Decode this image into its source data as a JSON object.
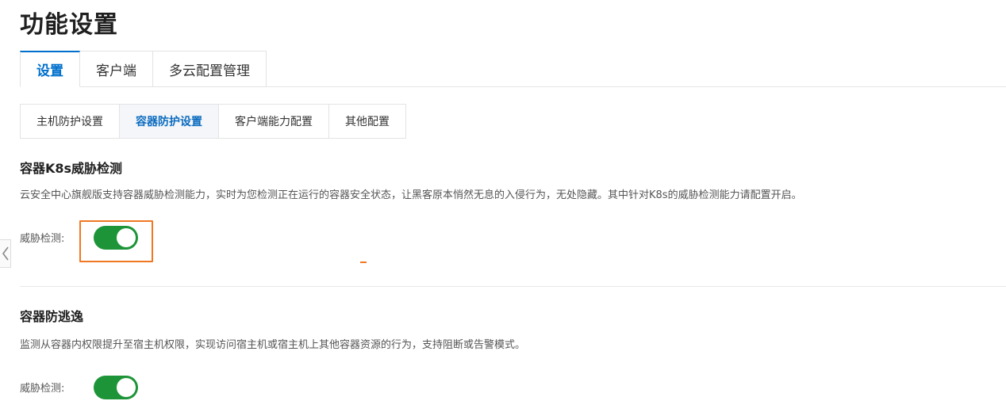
{
  "page": {
    "title": "功能设置"
  },
  "main_tabs": [
    {
      "label": "设置",
      "active": true
    },
    {
      "label": "客户端",
      "active": false
    },
    {
      "label": "多云配置管理",
      "active": false
    }
  ],
  "sub_tabs": [
    {
      "label": "主机防护设置",
      "active": false
    },
    {
      "label": "容器防护设置",
      "active": true
    },
    {
      "label": "客户端能力配置",
      "active": false
    },
    {
      "label": "其他配置",
      "active": false
    }
  ],
  "sections": [
    {
      "title": "容器K8s威胁检测",
      "description": "云安全中心旗舰版支持容器威胁检测能力，实时为您检测正在运行的容器安全状态，让黑客原本悄然无息的入侵行为，无处隐藏。其中针对K8s的威胁检测能力请配置开启。",
      "field_label": "威胁检测:",
      "toggle_on": true
    },
    {
      "title": "容器防逃逸",
      "description": "监测从容器内权限提升至宿主机权限，实现访问宿主机或宿主机上其他容器资源的行为，支持阻断或告警模式。",
      "field_label": "威胁检测:",
      "toggle_on": true
    }
  ],
  "colors": {
    "accent": "#0070cc",
    "toggle_on": "#1d9437",
    "highlight": "#f07823"
  },
  "icons": {
    "collapse": "chevron-left-icon"
  }
}
